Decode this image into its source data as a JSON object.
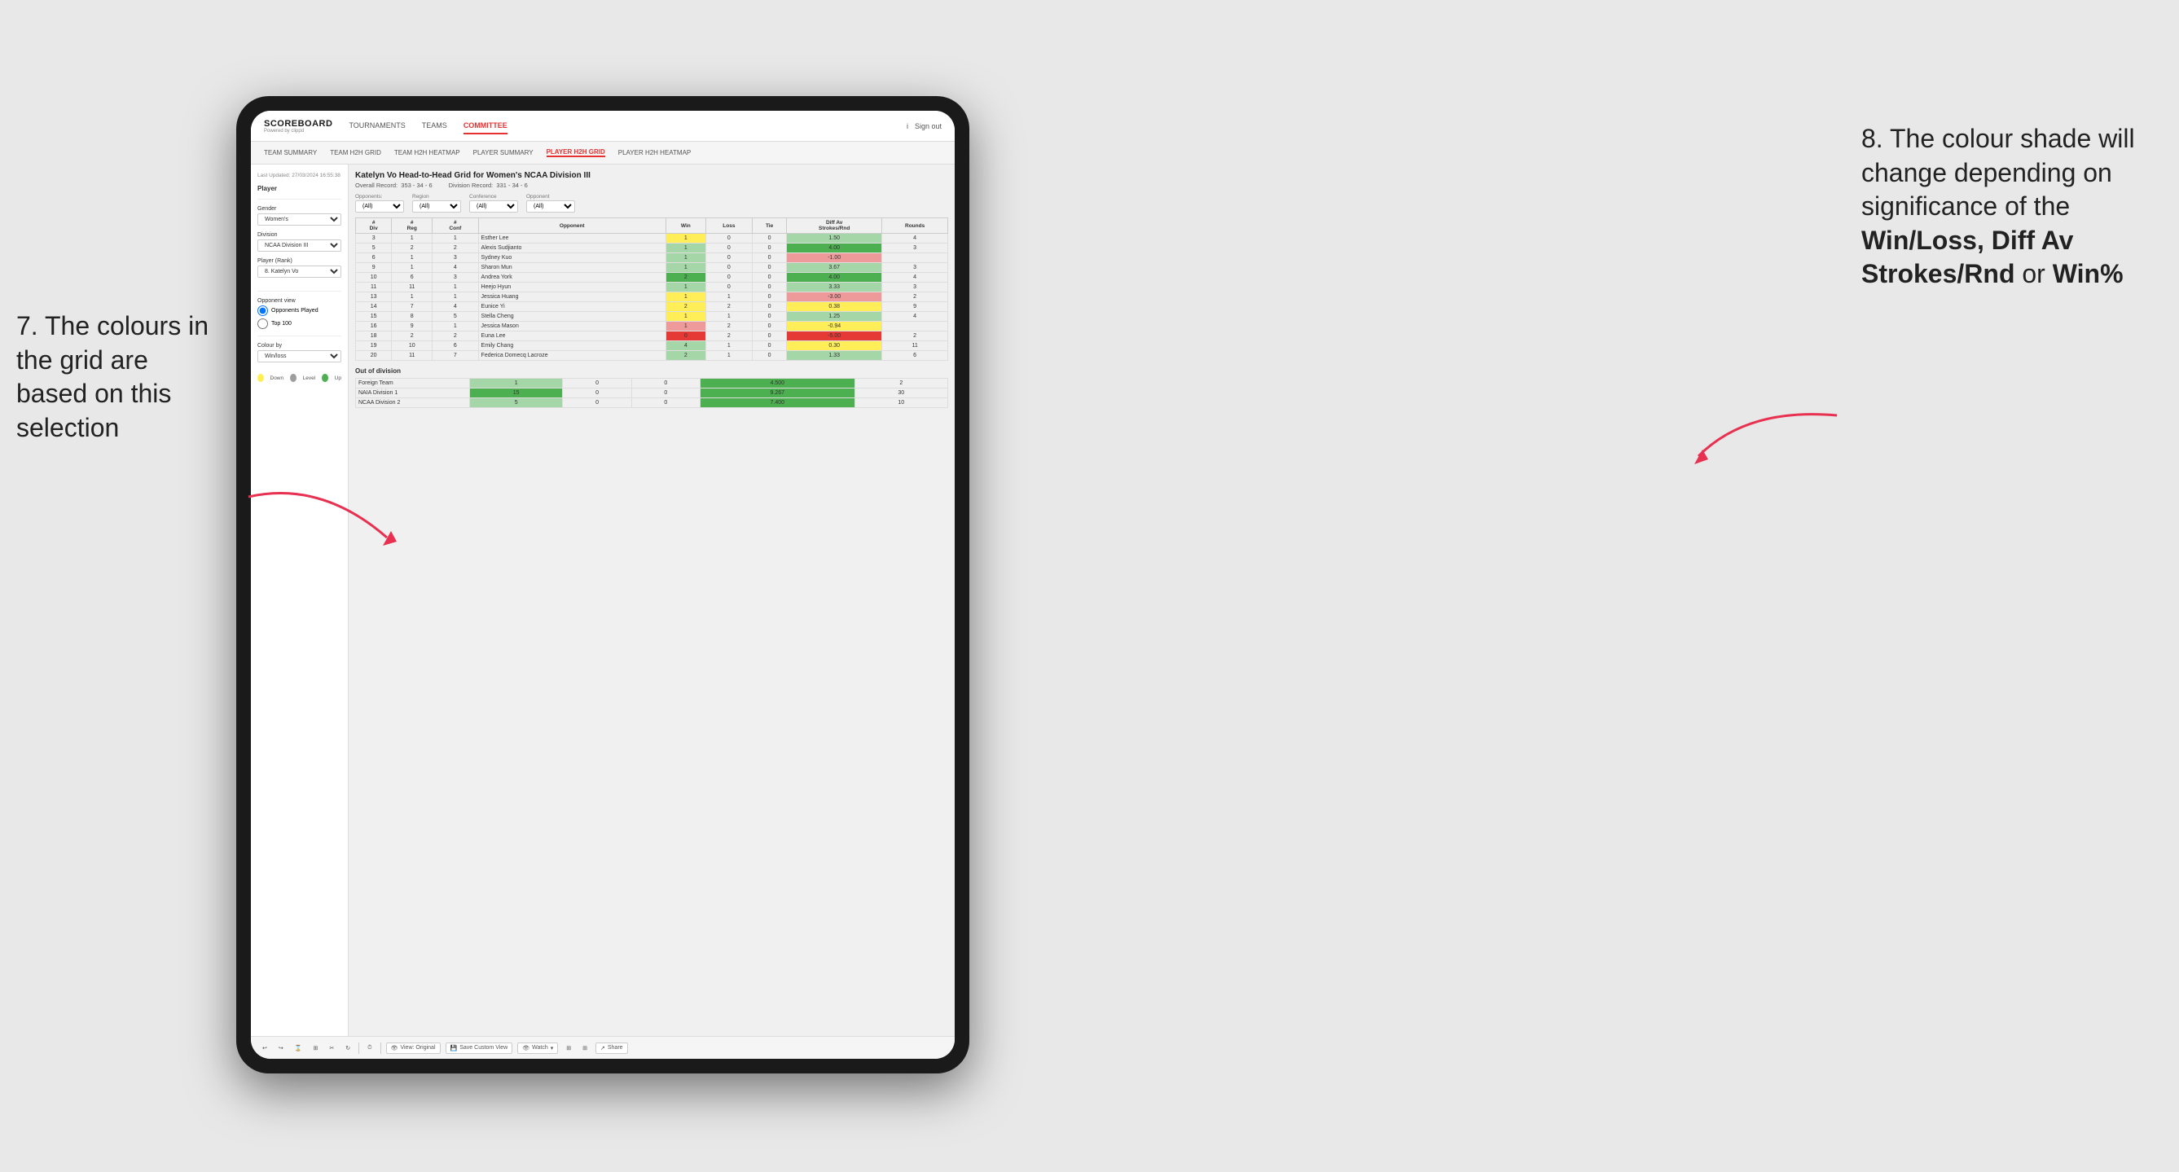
{
  "annotations": {
    "left_title": "7. The colours in the grid are based on this selection",
    "right_title": "8. The colour shade will change depending on significance of the ",
    "right_bold": "Win/Loss, Diff Av Strokes/Rnd",
    "right_suffix": " or ",
    "right_bold2": "Win%"
  },
  "nav": {
    "logo": "SCOREBOARD",
    "logo_sub": "Powered by clippd",
    "links": [
      "TOURNAMENTS",
      "TEAMS",
      "COMMITTEE"
    ],
    "active_link": "COMMITTEE",
    "sign_in_icon": "i",
    "sign_out": "Sign out"
  },
  "sub_nav": {
    "links": [
      "TEAM SUMMARY",
      "TEAM H2H GRID",
      "TEAM H2H HEATMAP",
      "PLAYER SUMMARY",
      "PLAYER H2H GRID",
      "PLAYER H2H HEATMAP"
    ],
    "active": "PLAYER H2H GRID"
  },
  "sidebar": {
    "last_updated": "Last Updated: 27/03/2024 16:55:38",
    "player_section": "Player",
    "gender_label": "Gender",
    "gender_value": "Women's",
    "division_label": "Division",
    "division_value": "NCAA Division III",
    "player_rank_label": "Player (Rank)",
    "player_rank_value": "8. Katelyn Vo",
    "opponent_view_label": "Opponent view",
    "radio1": "Opponents Played",
    "radio2": "Top 100",
    "colour_by_label": "Colour by",
    "colour_by_value": "Win/loss",
    "legend_down": "Down",
    "legend_level": "Level",
    "legend_up": "Up"
  },
  "grid": {
    "title": "Katelyn Vo Head-to-Head Grid for Women's NCAA Division III",
    "overall_record_label": "Overall Record:",
    "overall_record": "353 - 34 - 6",
    "division_record_label": "Division Record:",
    "division_record": "331 - 34 - 6",
    "opponents_label": "Opponents:",
    "opponents_value": "(All)",
    "region_label": "Region",
    "conference_label": "Conference",
    "opponent_label": "Opponent",
    "col_headers": [
      "#\nDiv",
      "#\nReg",
      "#\nConf",
      "Opponent",
      "Win",
      "Loss",
      "Tie",
      "Diff Av\nStrokes/Rnd",
      "Rounds"
    ],
    "rows": [
      {
        "div": 3,
        "reg": 1,
        "conf": 1,
        "opponent": "Esther Lee",
        "win": 1,
        "loss": 0,
        "tie": 0,
        "diff": 1.5,
        "rounds": 4,
        "win_color": "yellow",
        "diff_color": "green-light"
      },
      {
        "div": 5,
        "reg": 2,
        "conf": 2,
        "opponent": "Alexis Sudjianto",
        "win": 1,
        "loss": 0,
        "tie": 0,
        "diff": 4.0,
        "rounds": 3,
        "win_color": "green-light",
        "diff_color": "green-dark"
      },
      {
        "div": 6,
        "reg": 1,
        "conf": 3,
        "opponent": "Sydney Kuo",
        "win": 1,
        "loss": 0,
        "tie": 0,
        "diff": -1.0,
        "rounds": "",
        "win_color": "green-light",
        "diff_color": "red-light"
      },
      {
        "div": 9,
        "reg": 1,
        "conf": 4,
        "opponent": "Sharon Mun",
        "win": 1,
        "loss": 0,
        "tie": 0,
        "diff": 3.67,
        "rounds": 3,
        "win_color": "green-light",
        "diff_color": "green-light"
      },
      {
        "div": 10,
        "reg": 6,
        "conf": 3,
        "opponent": "Andrea York",
        "win": 2,
        "loss": 0,
        "tie": 0,
        "diff": 4.0,
        "rounds": 4,
        "win_color": "green-dark",
        "diff_color": "green-dark"
      },
      {
        "div": 11,
        "reg": 11,
        "conf": 1,
        "opponent": "Heejo Hyun",
        "win": 1,
        "loss": 0,
        "tie": 0,
        "diff": 3.33,
        "rounds": 3,
        "win_color": "green-light",
        "diff_color": "green-light"
      },
      {
        "div": 13,
        "reg": 1,
        "conf": 1,
        "opponent": "Jessica Huang",
        "win": 1,
        "loss": 1,
        "tie": 0,
        "diff": -3.0,
        "rounds": 2,
        "win_color": "yellow",
        "diff_color": "red-light"
      },
      {
        "div": 14,
        "reg": 7,
        "conf": 4,
        "opponent": "Eunice Yi",
        "win": 2,
        "loss": 2,
        "tie": 0,
        "diff": 0.38,
        "rounds": 9,
        "win_color": "yellow",
        "diff_color": "yellow"
      },
      {
        "div": 15,
        "reg": 8,
        "conf": 5,
        "opponent": "Stella Cheng",
        "win": 1,
        "loss": 1,
        "tie": 0,
        "diff": 1.25,
        "rounds": 4,
        "win_color": "yellow",
        "diff_color": "green-light"
      },
      {
        "div": 16,
        "reg": 9,
        "conf": 1,
        "opponent": "Jessica Mason",
        "win": 1,
        "loss": 2,
        "tie": 0,
        "diff": -0.94,
        "rounds": "",
        "win_color": "red-light",
        "diff_color": "yellow"
      },
      {
        "div": 18,
        "reg": 2,
        "conf": 2,
        "opponent": "Euna Lee",
        "win": 0,
        "loss": 2,
        "tie": 0,
        "diff": -5.0,
        "rounds": 2,
        "win_color": "red-dark",
        "diff_color": "red-dark"
      },
      {
        "div": 19,
        "reg": 10,
        "conf": 6,
        "opponent": "Emily Chang",
        "win": 4,
        "loss": 1,
        "tie": 0,
        "diff": 0.3,
        "rounds": 11,
        "win_color": "green-light",
        "diff_color": "yellow"
      },
      {
        "div": 20,
        "reg": 11,
        "conf": 7,
        "opponent": "Federica Domecq Lacroze",
        "win": 2,
        "loss": 1,
        "tie": 0,
        "diff": 1.33,
        "rounds": 6,
        "win_color": "green-light",
        "diff_color": "green-light"
      }
    ],
    "out_of_division_label": "Out of division",
    "out_of_division_rows": [
      {
        "label": "Foreign Team",
        "win": 1,
        "loss": 0,
        "tie": 0,
        "diff": 4.5,
        "rounds": 2,
        "win_color": "green-light",
        "diff_color": "green-dark"
      },
      {
        "label": "NAIA Division 1",
        "win": 15,
        "loss": 0,
        "tie": 0,
        "diff": 9.267,
        "rounds": 30,
        "win_color": "green-dark",
        "diff_color": "green-dark"
      },
      {
        "label": "NCAA Division 2",
        "win": 5,
        "loss": 0,
        "tie": 0,
        "diff": 7.4,
        "rounds": 10,
        "win_color": "green-light",
        "diff_color": "green-dark"
      }
    ]
  },
  "toolbar": {
    "view_original": "View: Original",
    "save_custom_view": "Save Custom View",
    "watch": "Watch",
    "share": "Share"
  }
}
